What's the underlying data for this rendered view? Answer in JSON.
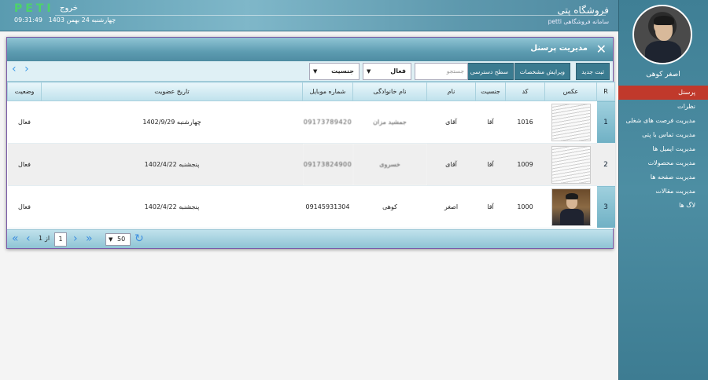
{
  "header": {
    "store_title": "فروشگاه پتی",
    "store_subtitle": "سامانه فروشگاهی petti",
    "brand": "PETI",
    "logout": "خروج",
    "date": "چهارشنبه 24 بهمن 1403",
    "time": "09:31:49"
  },
  "sidebar": {
    "user_name": "اصغر کوهی",
    "items": [
      {
        "label": "پرسنل",
        "active": true
      },
      {
        "label": "نظرات"
      },
      {
        "label": "مدیریت فرصت های شغلی"
      },
      {
        "label": "مدیریت تماس با پتی"
      },
      {
        "label": "مدیریت ایمیل ها"
      },
      {
        "label": "مدیریت محصولات"
      },
      {
        "label": "مدیریت صفحه ها"
      },
      {
        "label": "مدیریت مقالات"
      },
      {
        "label": "لاگ ها"
      }
    ]
  },
  "panel": {
    "title": "مدیریت پرسنل",
    "toolbar": {
      "new_label": "ثبت جدید",
      "edit_label": "ویرایش مشخصات",
      "access_label": "سطح دسترسی",
      "search_placeholder": "جستجو",
      "status_select": "فعال",
      "gender_select": "جنسیت"
    },
    "columns": [
      "R",
      "عکس",
      "کد",
      "جنسیت",
      "نام",
      "نام خانوادگی",
      "شماره موبایل",
      "تاریخ عضویت",
      "وضعیت"
    ],
    "rows": [
      {
        "r": "1",
        "code": "1016",
        "gender": "آقا",
        "first": "آقای",
        "last": "جمشید مزان",
        "mobile": "09173789420",
        "joined": "چهارشنبه 1402/9/29",
        "status": "فعال",
        "photo": "doc"
      },
      {
        "r": "2",
        "code": "1009",
        "gender": "آقا",
        "first": "آقای",
        "last": "خسروی",
        "mobile": "09173824900",
        "joined": "پنجشنبه 1402/4/22",
        "status": "فعال",
        "photo": "doc"
      },
      {
        "r": "3",
        "code": "1000",
        "gender": "آقا",
        "first": "اصغر",
        "last": "کوهی",
        "mobile": "09145931304",
        "joined": "پنجشنبه 1402/4/22",
        "status": "فعال",
        "photo": "person"
      }
    ],
    "pager": {
      "page": "1",
      "of_label": "از",
      "total_pages": "1",
      "page_size": "50"
    }
  }
}
